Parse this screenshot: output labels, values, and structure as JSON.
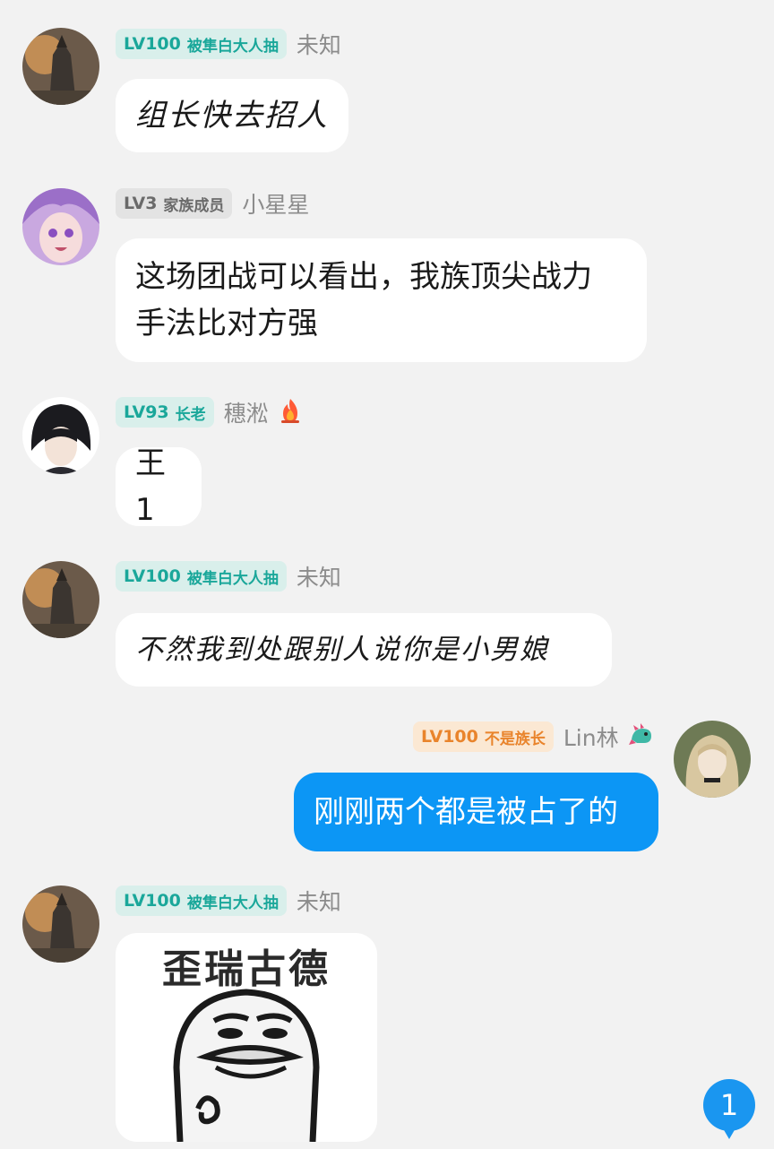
{
  "messages": [
    {
      "level": "LV100",
      "title": "被隼白大人抽",
      "name": "未知",
      "text": "组长快去招人"
    },
    {
      "level": "LV3",
      "title": "家族成员",
      "name": "小星星",
      "text_lines": [
        "这场团战可以看出，我族顶尖战力",
        "手法比对方强"
      ]
    },
    {
      "level": "LV93",
      "title": "长老",
      "name": "穗淞",
      "text": "王1"
    },
    {
      "level": "LV100",
      "title": "被隼白大人抽",
      "name": "未知",
      "text": "不然我到处跟别人说你是小男娘"
    },
    {
      "level": "LV100",
      "title": "不是族长",
      "name": "Lin林",
      "text": "刚刚两个都是被占了的"
    },
    {
      "level": "LV100",
      "title": "被隼白大人抽",
      "name": "未知",
      "image_caption": "歪瑞古德"
    }
  ],
  "unread_count": "1",
  "colors": {
    "teal_badge": "#1aa79a",
    "grey_badge": "#6a6a6a",
    "orange_badge": "#e9842c",
    "my_bubble": "#0c96f5"
  },
  "icons": {
    "flame": "fire-icon",
    "dragon": "dragon-icon"
  }
}
